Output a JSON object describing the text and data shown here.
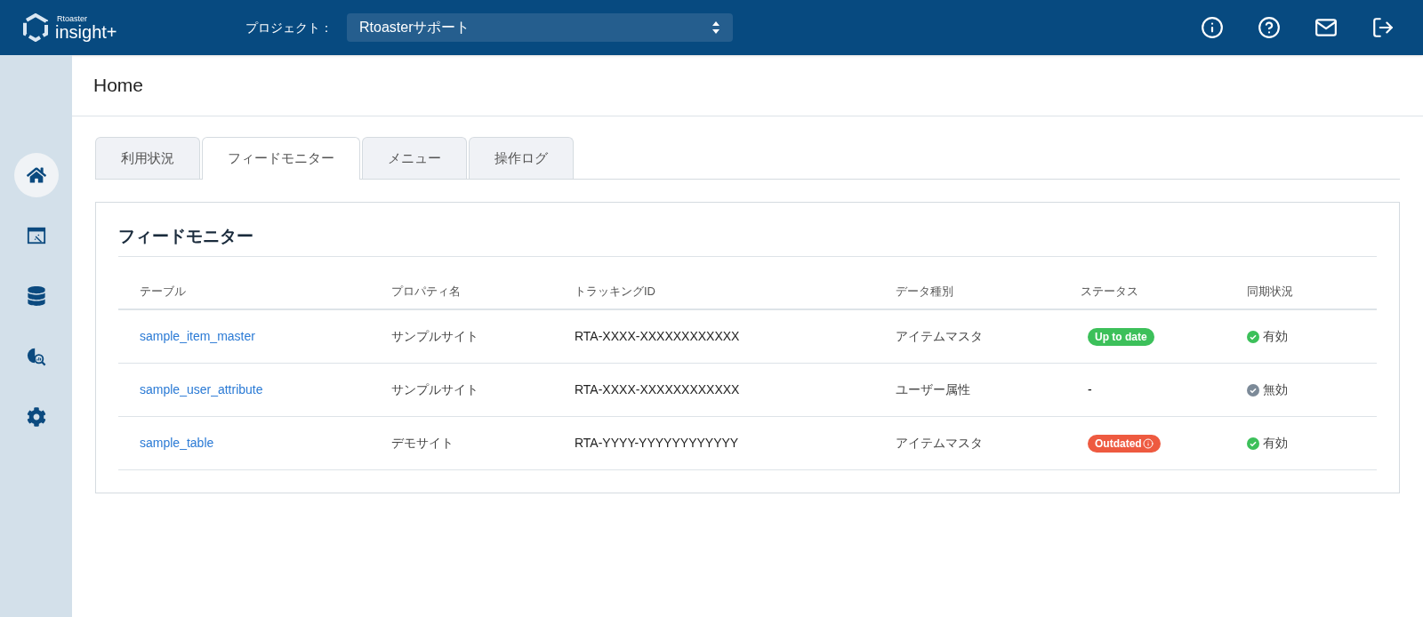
{
  "header": {
    "logo_small": "Rtoaster",
    "logo_main": "insight+",
    "project_label": "プロジェクト：",
    "project_value": "Rtoasterサポート"
  },
  "sidebar": {
    "items": [
      {
        "kind": "home",
        "selected": true
      },
      {
        "kind": "screen",
        "selected": false
      },
      {
        "kind": "database",
        "selected": false
      },
      {
        "kind": "analysis",
        "selected": false
      },
      {
        "kind": "settings",
        "selected": false
      }
    ]
  },
  "page_title": "Home",
  "tabs": [
    {
      "label": "利用状況",
      "selected": false
    },
    {
      "label": "フィードモニター",
      "selected": true
    },
    {
      "label": "メニュー",
      "selected": false
    },
    {
      "label": "操作ログ",
      "selected": false
    }
  ],
  "panel": {
    "title": "フィードモニター",
    "table": {
      "columns": [
        "テーブル",
        "プロパティ名",
        "トラッキングID",
        "データ種別",
        "ステータス",
        "同期状況"
      ],
      "rows": [
        {
          "table": "sample_item_master",
          "property": "サンプルサイト",
          "tracking_id": "RTA-XXXX-XXXXXXXXXXXX",
          "data_type": "アイテムマスタ",
          "status": {
            "kind": "uptodate",
            "label": "Up to date"
          },
          "sync": {
            "enabled": true,
            "label": "有効"
          }
        },
        {
          "table": "sample_user_attribute",
          "property": "サンプルサイト",
          "tracking_id": "RTA-XXXX-XXXXXXXXXXXX",
          "data_type": "ユーザー属性",
          "status": {
            "kind": "none",
            "label": "-"
          },
          "sync": {
            "enabled": false,
            "label": "無効"
          }
        },
        {
          "table": "sample_table",
          "property": "デモサイト",
          "tracking_id": "RTA-YYYY-YYYYYYYYYYYY",
          "data_type": "アイテムマスタ",
          "status": {
            "kind": "outdated",
            "label": "Outdated"
          },
          "sync": {
            "enabled": true,
            "label": "有効"
          }
        }
      ]
    }
  }
}
